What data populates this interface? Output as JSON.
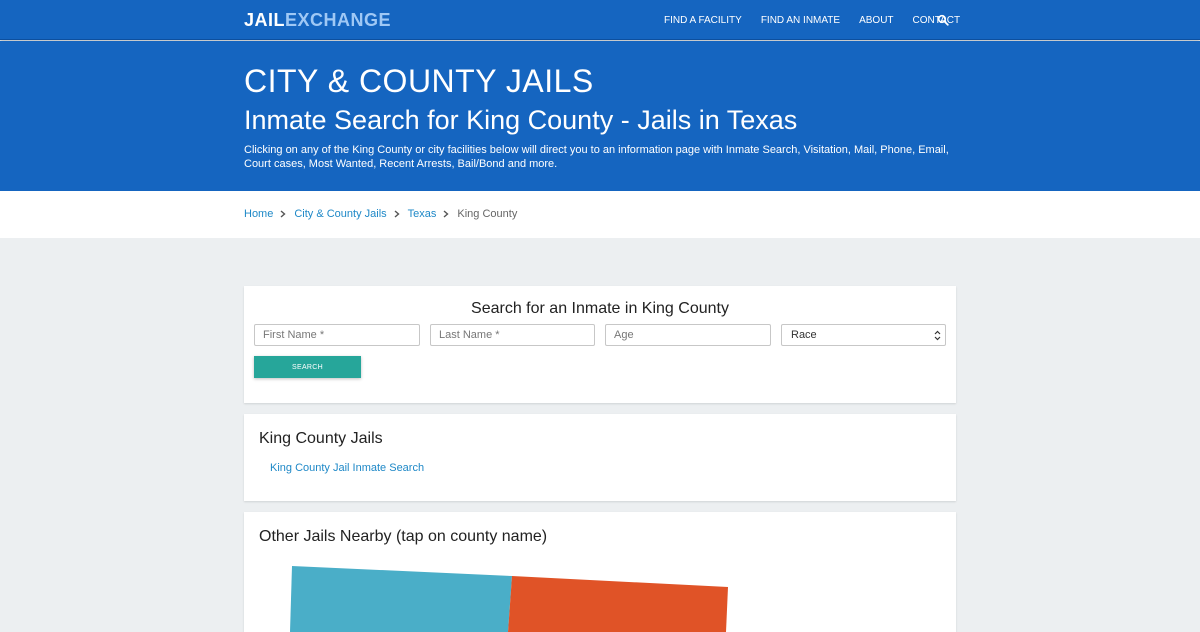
{
  "header": {
    "logo_part1": "JAIL",
    "logo_part2": "EXCHANGE",
    "nav": [
      "FIND A FACILITY",
      "FIND AN INMATE",
      "ABOUT",
      "CONTACT"
    ]
  },
  "hero": {
    "title": "CITY & COUNTY JAILS",
    "subtitle": "Inmate Search for King County - Jails in Texas",
    "description": "Clicking on any of the King County or city facilities below will direct you to an information page with Inmate Search, Visitation, Mail, Phone, Email, Court cases, Most Wanted, Recent Arrests, Bail/Bond and more."
  },
  "breadcrumb": {
    "items": [
      "Home",
      "City & County Jails",
      "Texas"
    ],
    "current": "King County"
  },
  "search_form": {
    "title": "Search for an Inmate in King County",
    "first_name_placeholder": "First Name *",
    "last_name_placeholder": "Last Name *",
    "age_placeholder": "Age",
    "race_selected": "Race",
    "button_label": "SEARCH"
  },
  "jails_section": {
    "title": "King County Jails",
    "links": [
      "King County Jail Inmate Search"
    ]
  },
  "nearby_section": {
    "title": "Other Jails Nearby (tap on county name)",
    "map_colors": [
      "#4aaec8",
      "#e05327"
    ]
  },
  "colors": {
    "brand_blue": "#1565c0",
    "link_blue": "#1e88c7",
    "button_teal": "#26a69a"
  }
}
